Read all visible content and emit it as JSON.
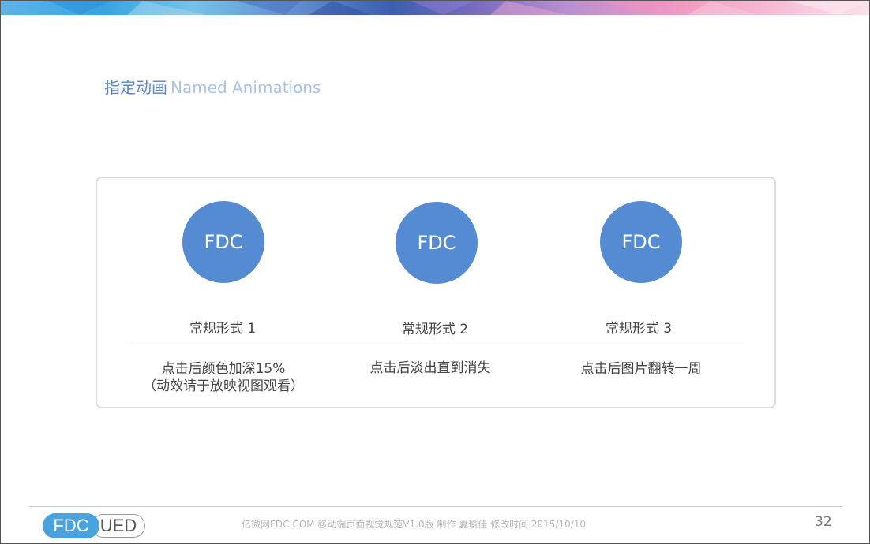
{
  "heading": {
    "zh": "指定动画",
    "en": "Named Animations"
  },
  "colors": {
    "accent": "#548bd3",
    "heading": "#5a87c6",
    "heading_en": "#a9c4e6"
  },
  "items": [
    {
      "circle_text": "FDC",
      "label": "常规形式 1",
      "desc_line1": "点击后颜色加深15%",
      "desc_line2": "（动效请于放映视图观看）"
    },
    {
      "circle_text": "FDC",
      "label": "常规形式 2",
      "desc_line1": "点击后淡出直到消失",
      "desc_line2": ""
    },
    {
      "circle_text": "FDC",
      "label": "常规形式 3",
      "desc_line1": "点击后图片翻转一周",
      "desc_line2": ""
    }
  ],
  "footer": {
    "logo_left": "FDC",
    "logo_right": "UED",
    "text": "亿微网FDC.COM 移动端页面视觉规范V1.0版   制作 夏瑜佳     修改时间   2015/10/10",
    "page_number": "32"
  }
}
